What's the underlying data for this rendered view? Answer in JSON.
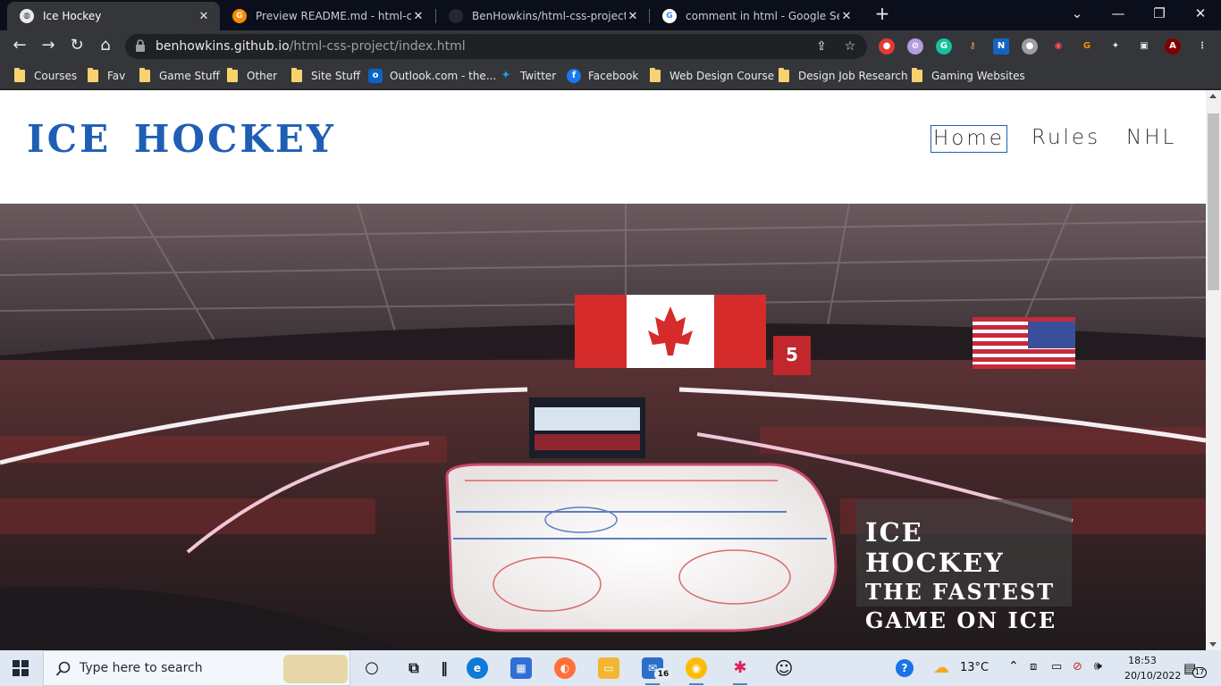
{
  "browser": {
    "tabs": [
      {
        "title": "Ice Hockey",
        "active": true,
        "favicon": "globe-icon",
        "color": "#e8eaed"
      },
      {
        "title": "Preview README.md - html-css-p",
        "active": false,
        "favicon": "gitpod-icon",
        "color": "#ff8a00"
      },
      {
        "title": "BenHowkins/html-css-project",
        "active": false,
        "favicon": "github-icon",
        "color": "#24292f"
      },
      {
        "title": "comment in html - Google Search",
        "active": false,
        "favicon": "google-icon",
        "color": "#ffffff"
      }
    ],
    "url": {
      "host": "benhowkins.github.io",
      "path": "/html-css-project/index.html"
    },
    "bookmarks": [
      {
        "label": "Courses",
        "type": "folder"
      },
      {
        "label": "Fav",
        "type": "folder"
      },
      {
        "label": "Game Stuff",
        "type": "folder"
      },
      {
        "label": "Other",
        "type": "folder"
      },
      {
        "label": "Site Stuff",
        "type": "folder"
      },
      {
        "label": "Outlook.com - the...",
        "type": "outlook-icon"
      },
      {
        "label": "Twitter",
        "type": "twitter-icon"
      },
      {
        "label": "Facebook",
        "type": "facebook-icon"
      },
      {
        "label": "Web Design Course",
        "type": "folder"
      },
      {
        "label": "Design Job Research",
        "type": "folder"
      },
      {
        "label": "Gaming Websites",
        "type": "folder"
      }
    ]
  },
  "site": {
    "logo": "ICE HOCKEY",
    "nav": [
      "Home",
      "Rules",
      "NHL"
    ],
    "hero": {
      "line1": "ICE HOCKEY",
      "line2": "THE FASTEST",
      "line3": "GAME ON ICE"
    },
    "jersey_number": "5",
    "colors": {
      "brand": "#1e5fb4"
    }
  },
  "taskbar": {
    "search_placeholder": "Type here to search",
    "temperature": "13°C",
    "time": "18:53",
    "date": "20/10/2022",
    "mail_badge": "16",
    "notifications": "17"
  }
}
